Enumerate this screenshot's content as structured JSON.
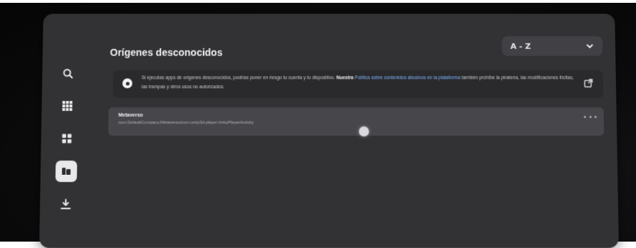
{
  "page": {
    "title": "Orígenes desconocidos"
  },
  "sort": {
    "selected": "A - Z"
  },
  "sidebar": {
    "items": [
      {
        "icon": "search-icon",
        "active": false
      },
      {
        "icon": "grid-icon",
        "active": false
      },
      {
        "icon": "apps-icon",
        "active": false
      },
      {
        "icon": "unknown-sources-icon",
        "active": true
      },
      {
        "icon": "download-icon",
        "active": false
      }
    ]
  },
  "warning": {
    "text_part1": "Si ejecutas apps de orígenes desconocidos, podrías poner en riesgo tu cuenta y tu dispositivo.",
    "text_strong": "Nuestra",
    "link_text": "Política sobre contenidos abusivos en la plataforma",
    "text_part2": "también prohíbe la piratería, las modificaciones ilícitas, las trampas y otros usos no autorizados."
  },
  "apps": [
    {
      "name": "Metaverso",
      "package": "com.DefaultCompany.Metaverso/com.unity3d.player.UnityPlayerActivity"
    }
  ],
  "colors": {
    "panel": "#323234",
    "row": "#47474b",
    "link": "#7fb3ff",
    "active_nav": "#e8e8ea"
  }
}
